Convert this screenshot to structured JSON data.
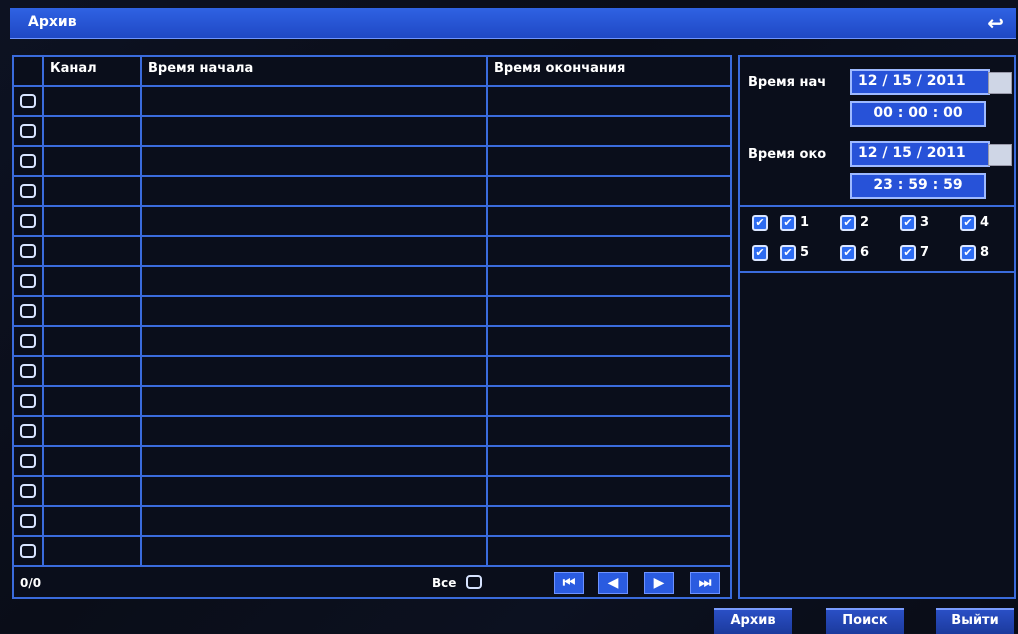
{
  "window": {
    "title": "Архив",
    "back_icon": "↩"
  },
  "table": {
    "headers": [
      "Канал",
      "Время начала",
      "Время окончания"
    ],
    "row_count": 16
  },
  "footer": {
    "count": "0/0",
    "all_label": "Все"
  },
  "nav": {
    "first": "⏮",
    "prev": "◀",
    "next": "▶",
    "last": "⏭"
  },
  "search": {
    "start_label": "Время нач",
    "start_date": "12 / 15 / 2011",
    "start_time": "00 : 00 : 00",
    "end_label": "Время око",
    "end_date": "12 / 15 / 2011",
    "end_time": "23 : 59 : 59"
  },
  "channels": [
    "1",
    "2",
    "3",
    "4",
    "5",
    "6",
    "7",
    "8"
  ],
  "check_mark": "✔",
  "buttons": {
    "archive": "Архив",
    "search": "Поиск",
    "exit": "Выйти"
  },
  "colors": {
    "accent": "#2f62e3",
    "border": "#3a6bdc",
    "background": "#0a0e1b"
  }
}
